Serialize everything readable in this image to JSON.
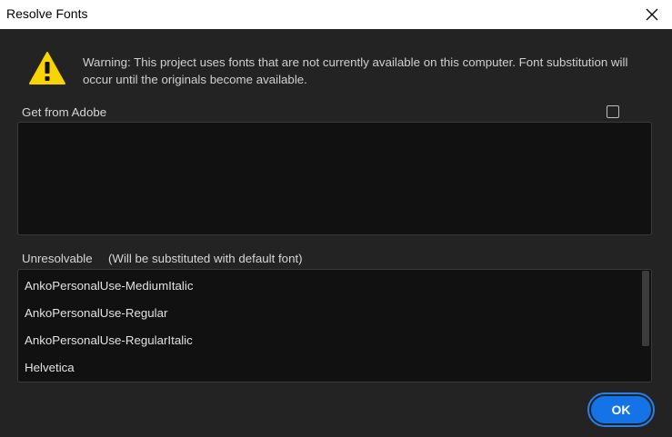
{
  "window": {
    "title": "Resolve Fonts"
  },
  "warning": {
    "icon": "warning-triangle-icon",
    "text": "Warning: This project uses fonts that are not currently available on this computer. Font substitution will occur until the originals become available."
  },
  "get_from_adobe": {
    "label": "Get from Adobe",
    "checked": false
  },
  "unresolvable": {
    "label": "Unresolvable",
    "note": "(Will be substituted with default font)",
    "fonts": [
      "AnkoPersonalUse-MediumItalic",
      "AnkoPersonalUse-Regular",
      "AnkoPersonalUse-RegularItalic",
      "Helvetica"
    ]
  },
  "buttons": {
    "ok": "OK"
  },
  "colors": {
    "accent": "#1473e6",
    "warning": "#f7d300",
    "background": "#232323",
    "panel": "#111111"
  }
}
